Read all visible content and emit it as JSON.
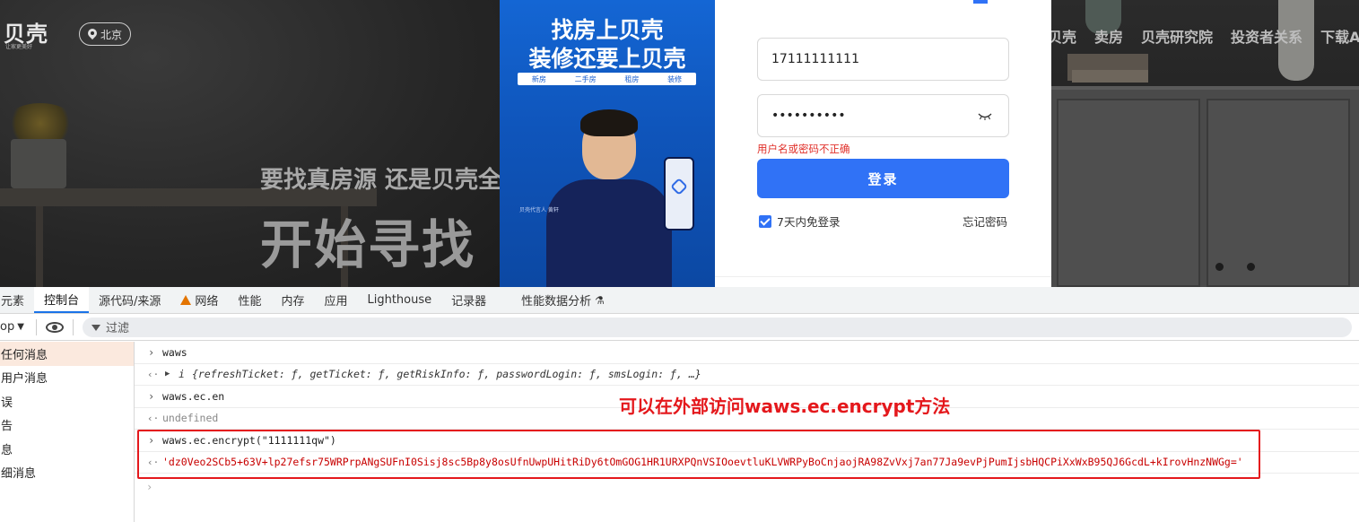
{
  "page": {
    "logo": "贝壳",
    "logo_tagline": "让家更美好",
    "city": "北京",
    "slogan_line1": "要找真房源 还是贝壳全",
    "slogan_line2": "开始寻找",
    "nav": [
      "贝壳",
      "卖房",
      "贝壳研究院",
      "投资者关系",
      "下载A"
    ],
    "ad": {
      "line1": "找房上贝壳",
      "line2": "装修还要上贝壳",
      "strip": [
        "新房",
        "二手房",
        "租房",
        "装修"
      ],
      "signature": "贝壳代言人 黄轩"
    },
    "login": {
      "phone_value": "17111111111",
      "password_value": "••••••••••",
      "error": "用户名或密码不正确",
      "submit": "登录",
      "remember": "7天内免登录",
      "forgot": "忘记密码"
    }
  },
  "devtools": {
    "tabs": [
      "元素",
      "控制台",
      "源代码/来源",
      "网络",
      "性能",
      "内存",
      "应用",
      "Lighthouse",
      "记录器",
      "性能数据分析"
    ],
    "active_tab": "控制台",
    "context": "op",
    "filter_placeholder": "过滤",
    "sidebar": [
      "任何消息",
      "用户消息",
      "误",
      "告",
      "息",
      "细消息"
    ],
    "console": {
      "cmd1": "waws",
      "obj1_name": "i",
      "obj1_preview": "{refreshTicket: ƒ, getTicket: ƒ, getRiskInfo: ƒ, passwordLogin: ƒ, smsLogin: ƒ,  …}",
      "cmd2": "waws.ec.en",
      "res2": "undefined",
      "cmd3": "waws.ec.encrypt(\"1111111qw\")",
      "res3": "'dz0Veo2SCb5+63V+lp27efsr75WRPrpANgSUFnI0Sisj8sc5Bp8y8osUfnUwpUHitRiDy6tOmGOG1HR1URXPQnVSIOoevtluKLVWRPyBoCnjaojRA98ZvVxj7an77Ja9evPjPumIjsbHQCPiXxWxB95QJ6GcdL+kIrovHnzNWGg='"
    }
  },
  "annotation": "可以在外部访问waws.ec.encrypt方法",
  "colors": {
    "accent": "#3072f6",
    "annotation_red": "#e4181c",
    "error_red": "#e0302a"
  }
}
